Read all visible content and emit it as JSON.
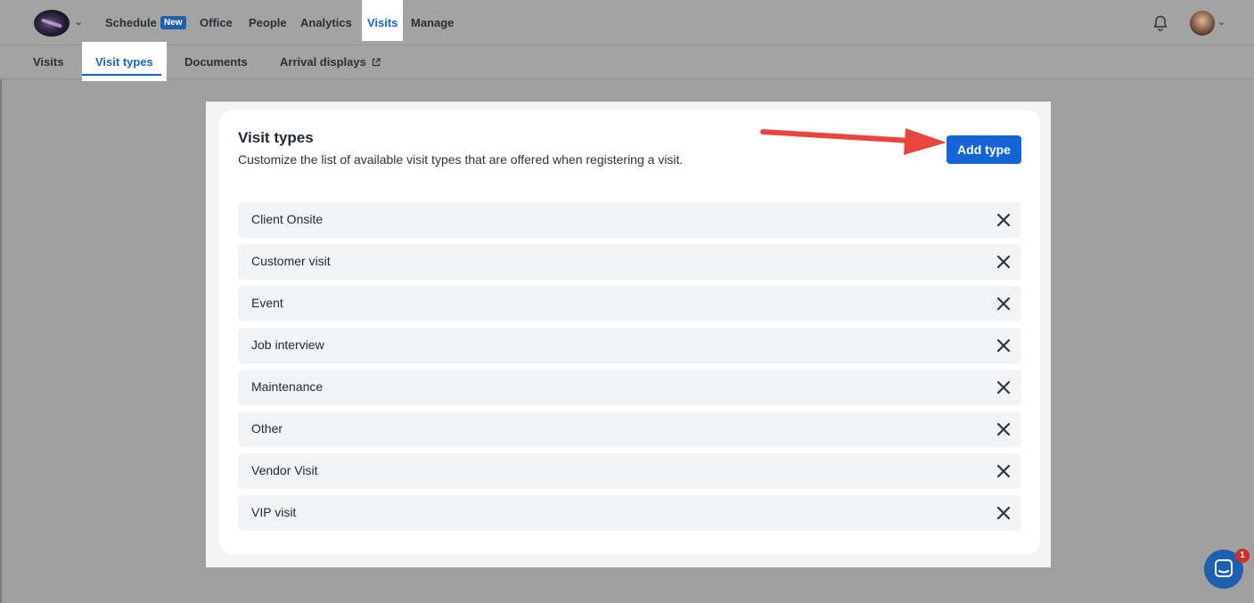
{
  "nav": {
    "items": [
      {
        "label": "Schedule",
        "badge": "New"
      },
      {
        "label": "Office"
      },
      {
        "label": "People"
      },
      {
        "label": "Analytics"
      },
      {
        "label": "Visits",
        "active": true
      },
      {
        "label": "Manage"
      }
    ]
  },
  "subnav": {
    "items": [
      {
        "label": "Visits"
      },
      {
        "label": "Visit types",
        "active": true
      },
      {
        "label": "Documents"
      },
      {
        "label": "Arrival displays",
        "external": true
      }
    ]
  },
  "card": {
    "title": "Visit types",
    "subtitle": "Customize the list of available visit types that are offered when registering a visit.",
    "add_button": "Add type"
  },
  "visit_types": [
    "Client Onsite",
    "Customer visit",
    "Event",
    "Job interview",
    "Maintenance",
    "Other",
    "Vendor Visit",
    "VIP visit"
  ],
  "chat": {
    "unread": "1"
  },
  "colors": {
    "accent": "#1564d6",
    "annotation_arrow": "#e8453c",
    "badge": "#d22c2c"
  }
}
